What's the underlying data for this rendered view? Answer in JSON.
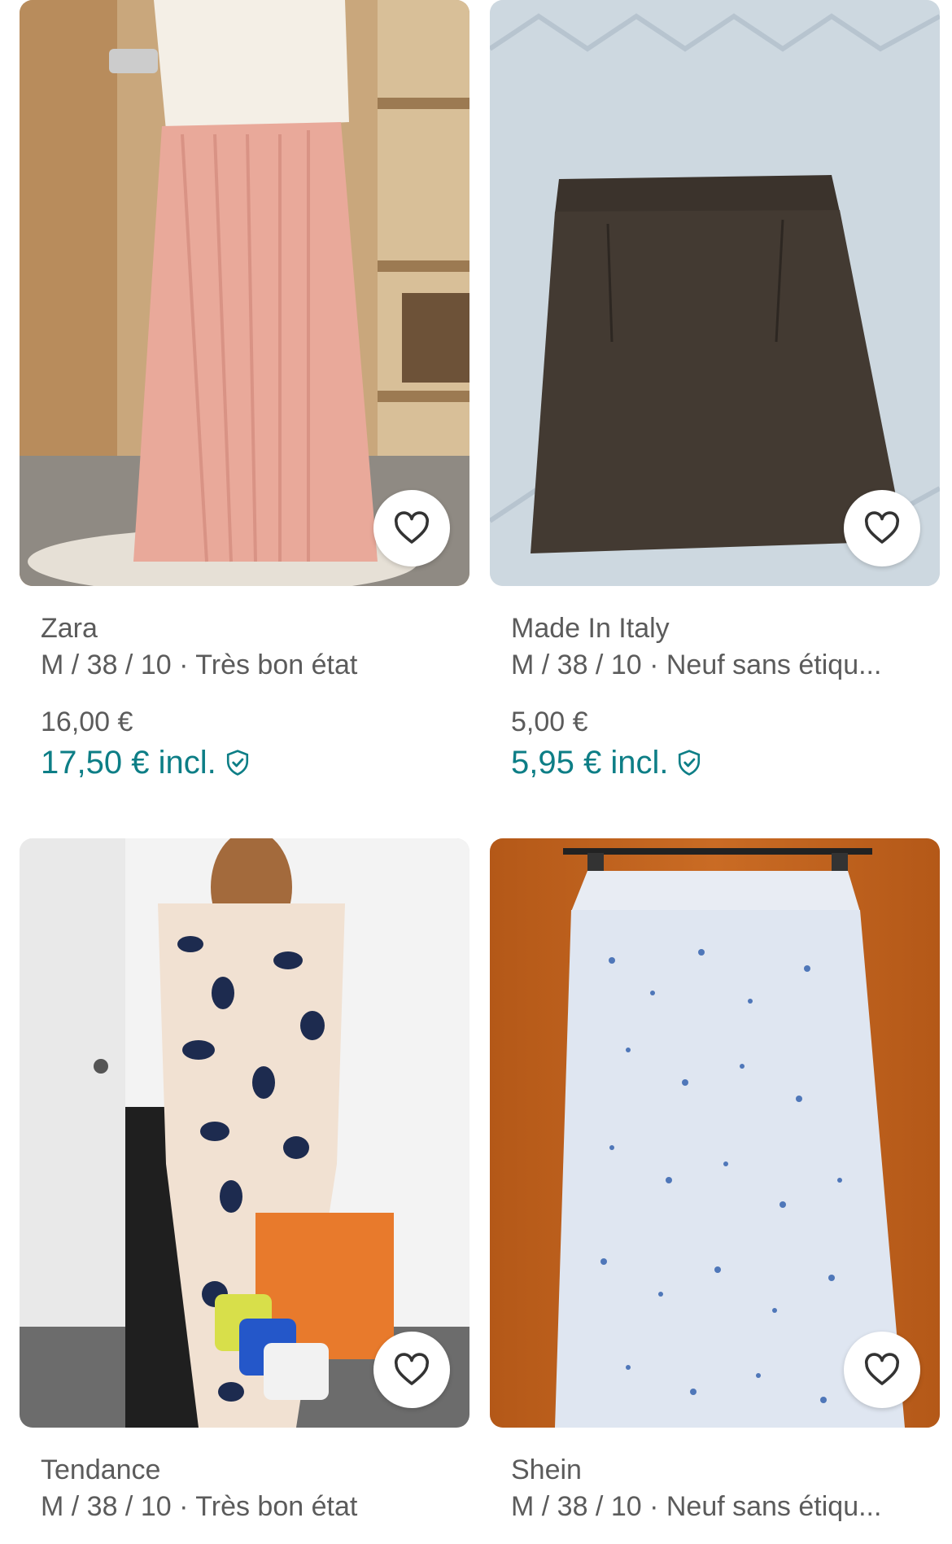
{
  "items": [
    {
      "brand": "Zara",
      "meta": "M / 38 / 10 · Très bon état",
      "price": "16,00 €",
      "price_incl": "17,50 € incl."
    },
    {
      "brand": "Made In Italy",
      "meta": "M / 38 / 10 · Neuf sans étiqu...",
      "price": "5,00 €",
      "price_incl": "5,95 € incl."
    },
    {
      "brand": "Tendance",
      "meta": "M / 38 / 10 · Très bon état"
    },
    {
      "brand": "Shein",
      "meta": "M / 38 / 10 · Neuf sans étiqu..."
    }
  ],
  "colors": {
    "accent": "#0d7e86",
    "muted_text": "#5b5b5b"
  },
  "icons": {
    "favorite": "heart-outline-icon",
    "protection": "shield-check-icon"
  }
}
